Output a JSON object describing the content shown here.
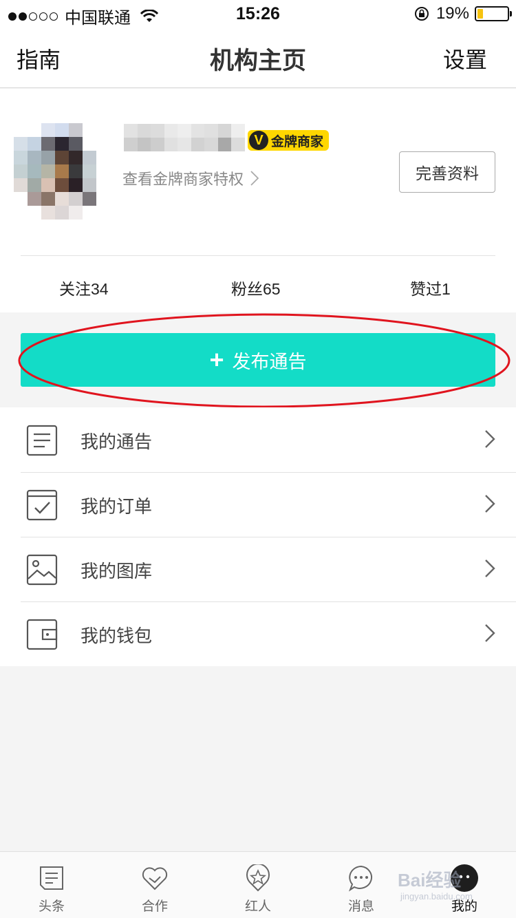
{
  "status_bar": {
    "carrier": "中国联通",
    "time": "15:26",
    "battery": "19%",
    "battery_level": 0.19,
    "signal_dots_filled": 2,
    "signal_dots_total": 5
  },
  "nav": {
    "left": "指南",
    "title": "机构主页",
    "right": "设置"
  },
  "profile": {
    "badge": "金牌商家",
    "badge_icon": "V",
    "privilege_link": "查看金牌商家特权",
    "complete_button": "完善资料",
    "stats": {
      "follow": "关注34",
      "fans": "粉丝65",
      "likes": "赞过1"
    }
  },
  "publish": {
    "label": "发布通告",
    "icon": "plus-icon",
    "color": "#13dcc7"
  },
  "menu": {
    "items": [
      {
        "label": "我的通告",
        "icon": "document-list-icon"
      },
      {
        "label": "我的订单",
        "icon": "order-check-icon"
      },
      {
        "label": "我的图库",
        "icon": "image-gallery-icon"
      },
      {
        "label": "我的钱包",
        "icon": "wallet-icon"
      }
    ]
  },
  "tabbar": {
    "items": [
      {
        "label": "头条",
        "icon": "news-icon"
      },
      {
        "label": "合作",
        "icon": "handshake-heart-icon"
      },
      {
        "label": "红人",
        "icon": "star-badge-icon"
      },
      {
        "label": "消息",
        "icon": "chat-bubble-icon"
      },
      {
        "label": "我的",
        "icon": "profile-face-icon"
      }
    ],
    "active_index": 4
  },
  "watermark": {
    "text": "Bai经验",
    "sub": "jingyan.baidu.com"
  }
}
